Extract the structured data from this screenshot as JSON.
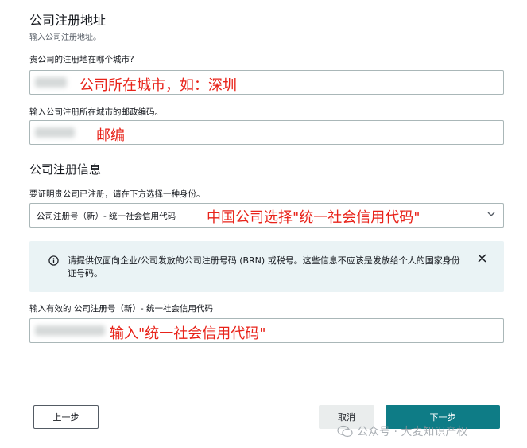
{
  "section1": {
    "title": "公司注册地址",
    "subtitle": "输入公司注册地址。",
    "city_label": "贵公司的注册地在哪个城市?",
    "city_annotation": "公司所在城市，如：深圳",
    "postal_label": "输入公司注册所在城市的邮政编码。",
    "postal_annotation": "邮编"
  },
  "section2": {
    "title": "公司注册信息",
    "id_label": "要证明贵公司已注册，请在下方选择一种身份。",
    "select_value": "公司注册号（新）- 统一社会信用代码",
    "select_annotation": "中国公司选择\"统一社会信用代码\"",
    "info_text": "请提供仅面向企业/公司发放的公司注册号码 (BRN) 或税号。这些信息不应该是发放给个人的国家身份证号码。",
    "reg_label": "输入有效的 公司注册号（新）- 统一社会信用代码",
    "reg_annotation": "输入\"统一社会信用代码\""
  },
  "buttons": {
    "prev": "上一步",
    "cancel": "取消",
    "next": "下一步"
  },
  "watermark": {
    "text": "公众号 · 大麦知识产权"
  },
  "colors": {
    "primary": "#0e7c86",
    "annotation": "#e8231a",
    "info_bg": "#eaf3f5"
  }
}
